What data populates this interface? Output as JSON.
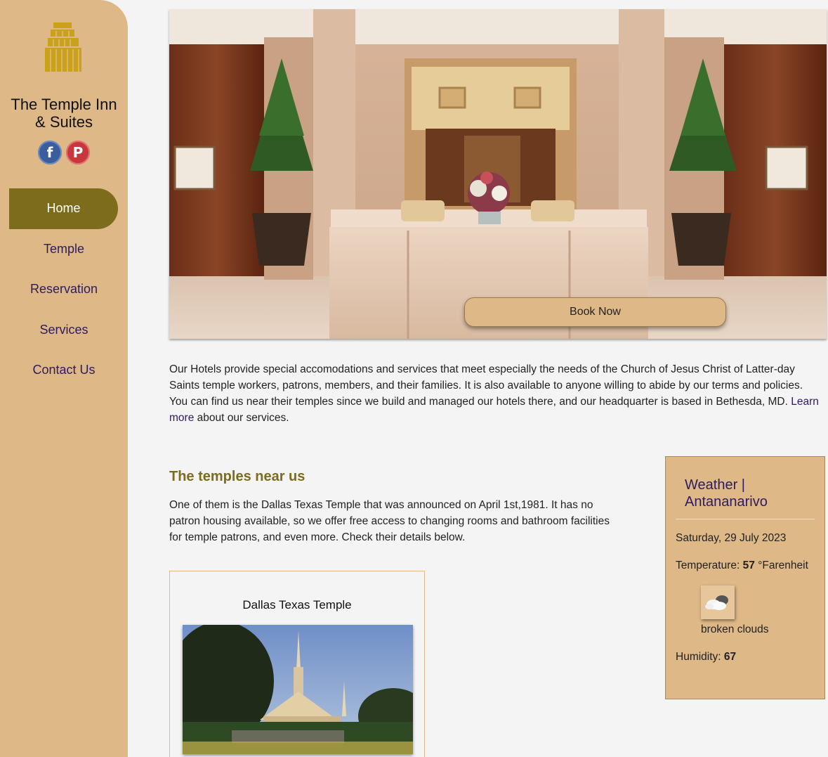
{
  "brand": {
    "name_line1": "The Temple Inn",
    "name_line2": "& Suites"
  },
  "social": {
    "facebook": "f",
    "pinterest": "P"
  },
  "nav": [
    {
      "label": "Home",
      "active": true
    },
    {
      "label": "Temple",
      "active": false
    },
    {
      "label": "Reservation",
      "active": false
    },
    {
      "label": "Services",
      "active": false
    },
    {
      "label": "Contact Us",
      "active": false
    }
  ],
  "hero": {
    "book_label": "Book Now"
  },
  "intro": {
    "text": "Our Hotels provide special accomodations and services that meet especially the needs of the Church of Jesus Christ of Latter-day Saints temple workers, patrons, members, and their families. It is also available to anyone willing to abide by our terms and policies. You can find us near their temples since we build and managed our hotels there, and our headquarter is based in Bethesda, MD.",
    "link": "Learn more",
    "tail": " about our services."
  },
  "temples": {
    "heading": "The temples near us",
    "text": "One of them is the Dallas Texas Temple that was announced on April 1st,1981. It has no patron housing available, so we offer free access to changing rooms and bathroom facilities for temple patrons, and even more. Check their details below.",
    "card_title": "Dallas Texas Temple"
  },
  "weather": {
    "title_line1": "Weather |",
    "title_line2": "Antananarivo",
    "date": "Saturday, 29 July 2023",
    "temp_label": "Temperature: ",
    "temp_value": "57",
    "temp_unit": " °Farenheit",
    "description": "broken clouds",
    "humidity_label": "Humidity: ",
    "humidity_value": "67"
  },
  "colors": {
    "sidebar": "#deb886",
    "accent": "#7c6c1c",
    "link": "#2d1b63",
    "background": "#f4f4f4"
  }
}
